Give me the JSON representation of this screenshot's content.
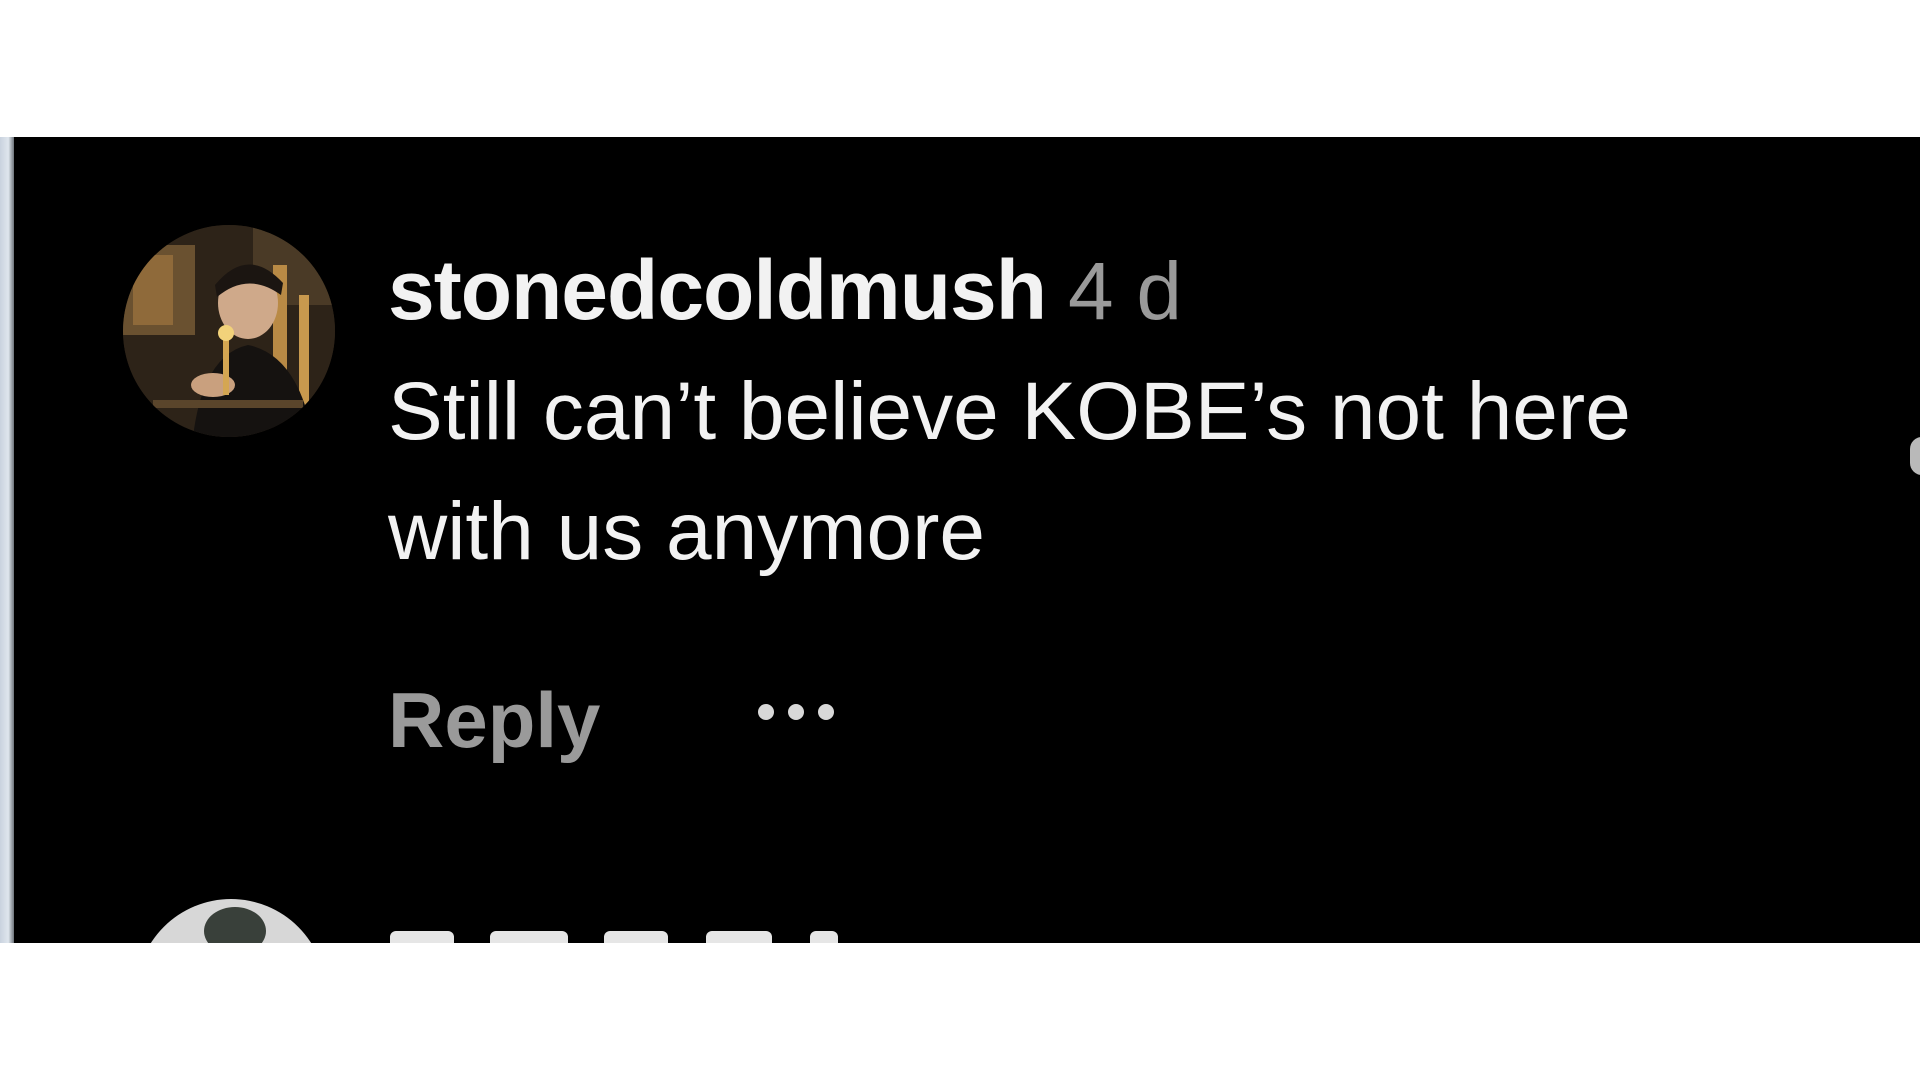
{
  "comment": {
    "username": "stonedcoldmush",
    "timestamp": "4 d",
    "text": "Still can’t believe KOBE’s not here with us anymore",
    "reply_label": "Reply",
    "more_icon": "more-options-icon"
  },
  "colors": {
    "background": "#000000",
    "primary_text": "#f2f2f2",
    "secondary_text": "#9a9a9a"
  }
}
